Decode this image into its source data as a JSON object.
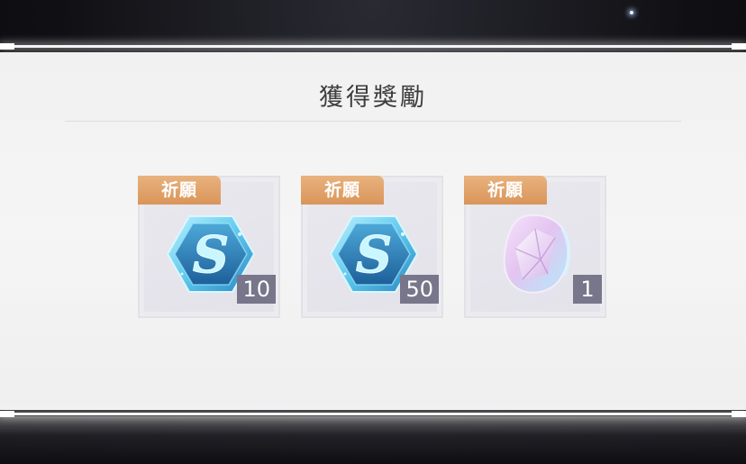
{
  "dialog": {
    "title": "獲得獎勵"
  },
  "rewards": [
    {
      "tag": "祈願",
      "icon": "s-hexagon-token-icon",
      "count": "10"
    },
    {
      "tag": "祈願",
      "icon": "s-hexagon-token-icon",
      "count": "50"
    },
    {
      "tag": "祈願",
      "icon": "prism-crystal-icon",
      "count": "1"
    }
  ],
  "colors": {
    "tag_orange": "#e0a26b",
    "count_badge": "#77768a",
    "token_blue": "#5fc9ec",
    "crystal_pink": "#e6c6ee"
  }
}
